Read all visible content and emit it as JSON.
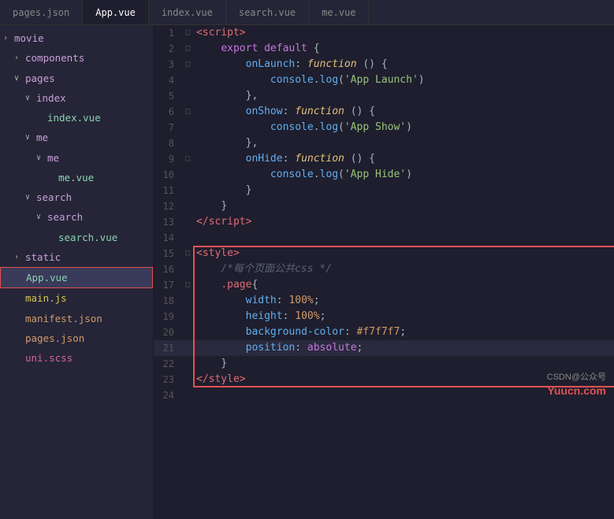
{
  "tabs": [
    {
      "label": "pages.json",
      "active": false
    },
    {
      "label": "App.vue",
      "active": true
    },
    {
      "label": "index.vue",
      "active": false
    },
    {
      "label": "search.vue",
      "active": false
    },
    {
      "label": "me.vue",
      "active": false
    }
  ],
  "sidebar": {
    "items": [
      {
        "indent": 0,
        "arrow": "›",
        "label": "movie",
        "type": "folder",
        "id": "movie"
      },
      {
        "indent": 1,
        "arrow": "›",
        "label": "components",
        "type": "folder",
        "id": "components"
      },
      {
        "indent": 1,
        "arrow": "∨",
        "label": "pages",
        "type": "folder",
        "id": "pages"
      },
      {
        "indent": 2,
        "arrow": "∨",
        "label": "index",
        "type": "folder",
        "id": "index"
      },
      {
        "indent": 3,
        "arrow": "",
        "label": "index.vue",
        "type": "vue",
        "id": "index.vue"
      },
      {
        "indent": 2,
        "arrow": "∨",
        "label": "me",
        "type": "folder",
        "id": "me"
      },
      {
        "indent": 3,
        "arrow": "∨",
        "label": "me",
        "type": "folder",
        "id": "me2"
      },
      {
        "indent": 4,
        "arrow": "",
        "label": "me.vue",
        "type": "vue",
        "id": "me.vue"
      },
      {
        "indent": 2,
        "arrow": "∨",
        "label": "search",
        "type": "folder",
        "id": "search"
      },
      {
        "indent": 3,
        "arrow": "∨",
        "label": "search",
        "type": "folder",
        "id": "search2"
      },
      {
        "indent": 4,
        "arrow": "",
        "label": "search.vue",
        "type": "vue",
        "id": "search.vue"
      },
      {
        "indent": 1,
        "arrow": "›",
        "label": "static",
        "type": "folder",
        "id": "static"
      },
      {
        "indent": 1,
        "arrow": "",
        "label": "App.vue",
        "type": "vue",
        "id": "App.vue",
        "selected": true
      },
      {
        "indent": 1,
        "arrow": "",
        "label": "main.js",
        "type": "js",
        "id": "main.js"
      },
      {
        "indent": 1,
        "arrow": "",
        "label": "manifest.json",
        "type": "json",
        "id": "manifest.json"
      },
      {
        "indent": 1,
        "arrow": "",
        "label": "pages.json",
        "type": "json",
        "id": "pages.json"
      },
      {
        "indent": 1,
        "arrow": "",
        "label": "uni.scss",
        "type": "scss",
        "id": "uni.scss"
      }
    ]
  },
  "code_lines": [
    {
      "num": 1,
      "fold": "□",
      "content": "&lt;script&gt;"
    },
    {
      "num": 2,
      "fold": "□",
      "content": "    export default {"
    },
    {
      "num": 3,
      "fold": "□",
      "content": "        onLaunch: function () {"
    },
    {
      "num": 4,
      "fold": "",
      "content": "            console.log('App Launch')"
    },
    {
      "num": 5,
      "fold": "",
      "content": "        },"
    },
    {
      "num": 6,
      "fold": "□",
      "content": "        onShow: function () {"
    },
    {
      "num": 7,
      "fold": "",
      "content": "            console.log('App Show')"
    },
    {
      "num": 8,
      "fold": "",
      "content": "        },"
    },
    {
      "num": 9,
      "fold": "□",
      "content": "        onHide: function () {"
    },
    {
      "num": 10,
      "fold": "",
      "content": "            console.log('App Hide')"
    },
    {
      "num": 11,
      "fold": "",
      "content": "        }"
    },
    {
      "num": 12,
      "fold": "",
      "content": "    }"
    },
    {
      "num": 13,
      "fold": "",
      "content": "&lt;/script&gt;"
    },
    {
      "num": 14,
      "fold": "",
      "content": ""
    },
    {
      "num": 15,
      "fold": "□",
      "content": "&lt;style&gt;"
    },
    {
      "num": 16,
      "fold": "",
      "content": "    /* 每个页面公共css */"
    },
    {
      "num": 17,
      "fold": "□",
      "content": "    .page{"
    },
    {
      "num": 18,
      "fold": "",
      "content": "        width: 100%;"
    },
    {
      "num": 19,
      "fold": "",
      "content": "        height: 100%;"
    },
    {
      "num": 20,
      "fold": "",
      "content": "        background-color: #f7f7f7;"
    },
    {
      "num": 21,
      "fold": "",
      "content": "        position: absolute;"
    },
    {
      "num": 22,
      "fold": "",
      "content": "    }"
    },
    {
      "num": 23,
      "fold": "",
      "content": "&lt;/style&gt;"
    },
    {
      "num": 24,
      "fold": "",
      "content": ""
    }
  ],
  "watermark": "Yuucn.com",
  "watermark2": "CSDN@公众号"
}
